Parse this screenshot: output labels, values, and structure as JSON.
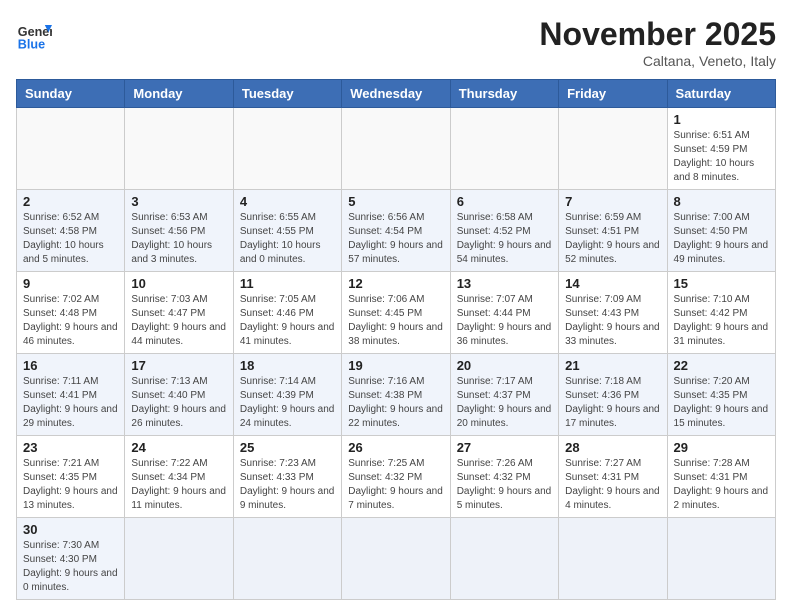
{
  "header": {
    "logo_line1": "General",
    "logo_line2": "Blue",
    "month_title": "November 2025",
    "subtitle": "Caltana, Veneto, Italy"
  },
  "weekdays": [
    "Sunday",
    "Monday",
    "Tuesday",
    "Wednesday",
    "Thursday",
    "Friday",
    "Saturday"
  ],
  "weeks": [
    [
      {
        "day": "",
        "info": ""
      },
      {
        "day": "",
        "info": ""
      },
      {
        "day": "",
        "info": ""
      },
      {
        "day": "",
        "info": ""
      },
      {
        "day": "",
        "info": ""
      },
      {
        "day": "",
        "info": ""
      },
      {
        "day": "1",
        "info": "Sunrise: 6:51 AM\nSunset: 4:59 PM\nDaylight: 10 hours and 8 minutes."
      }
    ],
    [
      {
        "day": "2",
        "info": "Sunrise: 6:52 AM\nSunset: 4:58 PM\nDaylight: 10 hours and 5 minutes."
      },
      {
        "day": "3",
        "info": "Sunrise: 6:53 AM\nSunset: 4:56 PM\nDaylight: 10 hours and 3 minutes."
      },
      {
        "day": "4",
        "info": "Sunrise: 6:55 AM\nSunset: 4:55 PM\nDaylight: 10 hours and 0 minutes."
      },
      {
        "day": "5",
        "info": "Sunrise: 6:56 AM\nSunset: 4:54 PM\nDaylight: 9 hours and 57 minutes."
      },
      {
        "day": "6",
        "info": "Sunrise: 6:58 AM\nSunset: 4:52 PM\nDaylight: 9 hours and 54 minutes."
      },
      {
        "day": "7",
        "info": "Sunrise: 6:59 AM\nSunset: 4:51 PM\nDaylight: 9 hours and 52 minutes."
      },
      {
        "day": "8",
        "info": "Sunrise: 7:00 AM\nSunset: 4:50 PM\nDaylight: 9 hours and 49 minutes."
      }
    ],
    [
      {
        "day": "9",
        "info": "Sunrise: 7:02 AM\nSunset: 4:48 PM\nDaylight: 9 hours and 46 minutes."
      },
      {
        "day": "10",
        "info": "Sunrise: 7:03 AM\nSunset: 4:47 PM\nDaylight: 9 hours and 44 minutes."
      },
      {
        "day": "11",
        "info": "Sunrise: 7:05 AM\nSunset: 4:46 PM\nDaylight: 9 hours and 41 minutes."
      },
      {
        "day": "12",
        "info": "Sunrise: 7:06 AM\nSunset: 4:45 PM\nDaylight: 9 hours and 38 minutes."
      },
      {
        "day": "13",
        "info": "Sunrise: 7:07 AM\nSunset: 4:44 PM\nDaylight: 9 hours and 36 minutes."
      },
      {
        "day": "14",
        "info": "Sunrise: 7:09 AM\nSunset: 4:43 PM\nDaylight: 9 hours and 33 minutes."
      },
      {
        "day": "15",
        "info": "Sunrise: 7:10 AM\nSunset: 4:42 PM\nDaylight: 9 hours and 31 minutes."
      }
    ],
    [
      {
        "day": "16",
        "info": "Sunrise: 7:11 AM\nSunset: 4:41 PM\nDaylight: 9 hours and 29 minutes."
      },
      {
        "day": "17",
        "info": "Sunrise: 7:13 AM\nSunset: 4:40 PM\nDaylight: 9 hours and 26 minutes."
      },
      {
        "day": "18",
        "info": "Sunrise: 7:14 AM\nSunset: 4:39 PM\nDaylight: 9 hours and 24 minutes."
      },
      {
        "day": "19",
        "info": "Sunrise: 7:16 AM\nSunset: 4:38 PM\nDaylight: 9 hours and 22 minutes."
      },
      {
        "day": "20",
        "info": "Sunrise: 7:17 AM\nSunset: 4:37 PM\nDaylight: 9 hours and 20 minutes."
      },
      {
        "day": "21",
        "info": "Sunrise: 7:18 AM\nSunset: 4:36 PM\nDaylight: 9 hours and 17 minutes."
      },
      {
        "day": "22",
        "info": "Sunrise: 7:20 AM\nSunset: 4:35 PM\nDaylight: 9 hours and 15 minutes."
      }
    ],
    [
      {
        "day": "23",
        "info": "Sunrise: 7:21 AM\nSunset: 4:35 PM\nDaylight: 9 hours and 13 minutes."
      },
      {
        "day": "24",
        "info": "Sunrise: 7:22 AM\nSunset: 4:34 PM\nDaylight: 9 hours and 11 minutes."
      },
      {
        "day": "25",
        "info": "Sunrise: 7:23 AM\nSunset: 4:33 PM\nDaylight: 9 hours and 9 minutes."
      },
      {
        "day": "26",
        "info": "Sunrise: 7:25 AM\nSunset: 4:32 PM\nDaylight: 9 hours and 7 minutes."
      },
      {
        "day": "27",
        "info": "Sunrise: 7:26 AM\nSunset: 4:32 PM\nDaylight: 9 hours and 5 minutes."
      },
      {
        "day": "28",
        "info": "Sunrise: 7:27 AM\nSunset: 4:31 PM\nDaylight: 9 hours and 4 minutes."
      },
      {
        "day": "29",
        "info": "Sunrise: 7:28 AM\nSunset: 4:31 PM\nDaylight: 9 hours and 2 minutes."
      }
    ],
    [
      {
        "day": "30",
        "info": "Sunrise: 7:30 AM\nSunset: 4:30 PM\nDaylight: 9 hours and 0 minutes."
      },
      {
        "day": "",
        "info": ""
      },
      {
        "day": "",
        "info": ""
      },
      {
        "day": "",
        "info": ""
      },
      {
        "day": "",
        "info": ""
      },
      {
        "day": "",
        "info": ""
      },
      {
        "day": "",
        "info": ""
      }
    ]
  ]
}
